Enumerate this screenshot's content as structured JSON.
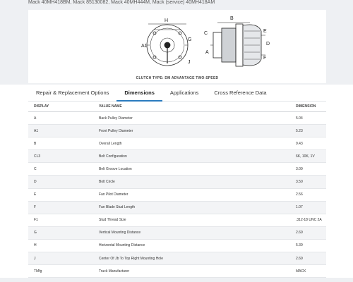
{
  "part_numbers": "Mack 40MH418BM, Mack 85130082, Mack 40MH444M, Mack (service) 40MH418AM",
  "figure": {
    "caption": "CLUTCH TYPE: DM ADVANTAGE TWO-SPEED",
    "labels": {
      "H": "H",
      "A1": "A1",
      "A": "A",
      "B": "B",
      "C": "C",
      "D": "D",
      "E": "E",
      "F": "F",
      "G": "G",
      "J": "J"
    }
  },
  "tabs": [
    {
      "label": "Repair & Replacement Options",
      "active": false
    },
    {
      "label": "Dimensions",
      "active": true
    },
    {
      "label": "Applications",
      "active": false
    },
    {
      "label": "Cross Reference Data",
      "active": false
    }
  ],
  "table": {
    "headers": {
      "display": "DISPLAY",
      "value_name": "VALUE NAME",
      "dimension": "DIMENSION"
    },
    "rows": [
      {
        "display": "A",
        "name": "Back Pulley Diameter",
        "value": "5.04"
      },
      {
        "display": "A1",
        "name": "Front Pulley Diameter",
        "value": "5.23"
      },
      {
        "display": "B",
        "name": "Overall Length",
        "value": "9.43"
      },
      {
        "display": "CL3",
        "name": "Belt Configuration",
        "value": "6K, 10K, 1V"
      },
      {
        "display": "C",
        "name": "Belt Groove Location",
        "value": "3.09"
      },
      {
        "display": "D",
        "name": "Bolt Circle",
        "value": "3.50"
      },
      {
        "display": "E",
        "name": "Fan Pilot Diameter",
        "value": "2.56"
      },
      {
        "display": "F",
        "name": "Fan Blade Stud Length",
        "value": "1.07"
      },
      {
        "display": "F1",
        "name": "Stud Thread Size",
        "value": ".312-18 UNC 2A"
      },
      {
        "display": "G",
        "name": "Vertical Mounting Distance",
        "value": "2.69"
      },
      {
        "display": "H",
        "name": "Horizontal Mounting Distance",
        "value": "5.39"
      },
      {
        "display": "J",
        "name": "Center Of Jb To Top Right Mounting Hole",
        "value": "2.69"
      },
      {
        "display": "TMfg",
        "name": "Truck Manufacturer",
        "value": "MACK"
      }
    ]
  }
}
